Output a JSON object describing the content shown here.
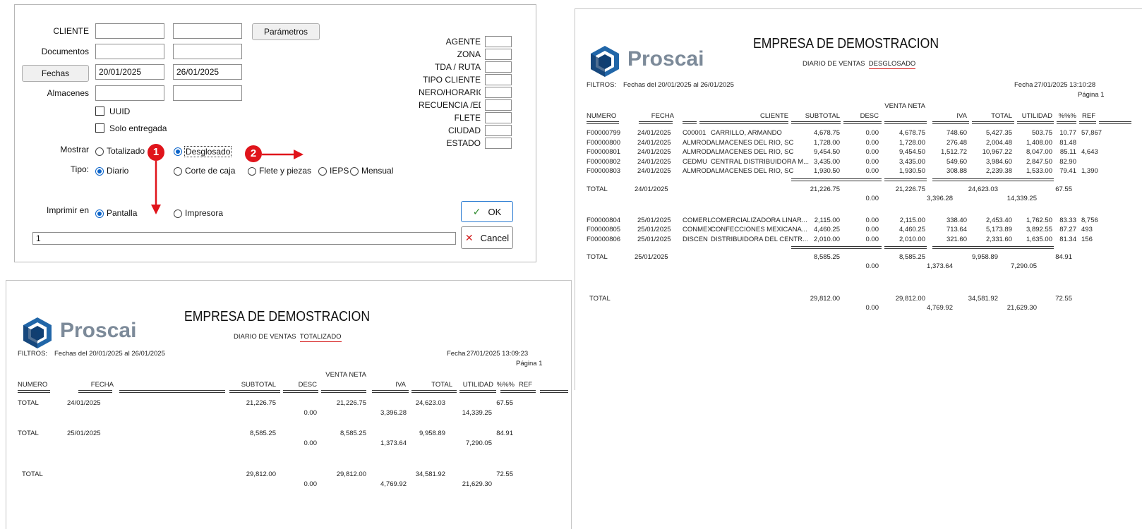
{
  "dialog": {
    "cliente_label": "CLIENTE",
    "documentos_label": "Documentos",
    "fechas_button": "Fechas",
    "fecha_desde": "20/01/2025",
    "fecha_hasta": "26/01/2025",
    "almacenes_label": "Almacenes",
    "parametros_button": "Parámetros",
    "uuid_label": "UUID",
    "solo_entregada_label": "Solo entregada",
    "mostrar_label": "Mostrar",
    "mostrar_options": [
      "Totalizado",
      "Desglosado"
    ],
    "mostrar_selected": "Desglosado",
    "tipo_label": "Tipo:",
    "tipo_options": [
      "Diario",
      "Corte de caja",
      "Flete y piezas",
      "IEPS",
      "Mensual"
    ],
    "tipo_selected": "Diario",
    "imprimir_label": "Imprimir en",
    "imprimir_options": [
      "Pantalla",
      "Impresora"
    ],
    "imprimir_selected": "Pantalla",
    "status_value": "1",
    "ok_button": "OK",
    "cancel_button": "Cancel",
    "right_filters": [
      "AGENTE",
      "ZONA",
      "TDA / RUTA",
      "TIPO CLIENTE",
      "NERO/HORARIO",
      "RECUENCIA /EDA",
      "FLETE",
      "CIUDAD",
      "ESTADO"
    ],
    "markers": [
      "1",
      "2"
    ]
  },
  "report_desglosado": {
    "logo": "Proscai",
    "title": "EMPRESA DE DEMOSTRACION",
    "subtitle_prefix": "DIARIO DE VENTAS",
    "subtitle_mode": "DESGLOSADO",
    "filtros_label": "FILTROS:",
    "filtros_text": "Fechas del 20/01/2025 al 26/01/2025",
    "fecha_label": "Fecha",
    "fecha_value": "27/01/2025 13:10:28",
    "pagina": "Página 1",
    "headers": [
      "NUMERO",
      "FECHA",
      "CLIENTE",
      "SUBTOTAL",
      "DESC",
      "VENTA NETA",
      "IVA",
      "TOTAL",
      "UTILIDAD",
      "%%%",
      "REF"
    ],
    "groups": [
      {
        "rows": [
          [
            "F00000799",
            "24/01/2025",
            "C00001",
            "CARRILLO, ARMANDO",
            "4,678.75",
            "0.00",
            "4,678.75",
            "748.60",
            "5,427.35",
            "503.75",
            "10.77",
            "57,867"
          ],
          [
            "F00000800",
            "24/01/2025",
            "ALMROD",
            "ALMACENES DEL RIO, SC",
            "1,728.00",
            "0.00",
            "1,728.00",
            "276.48",
            "2,004.48",
            "1,408.00",
            "81.48",
            ""
          ],
          [
            "F00000801",
            "24/01/2025",
            "ALMROD",
            "ALMACENES DEL RIO, SC",
            "9,454.50",
            "0.00",
            "9,454.50",
            "1,512.72",
            "10,967.22",
            "8,047.00",
            "85.11",
            "4,643"
          ],
          [
            "F00000802",
            "24/01/2025",
            "CEDMU",
            "CENTRAL DISTRIBUIDORA M...",
            "3,435.00",
            "0.00",
            "3,435.00",
            "549.60",
            "3,984.60",
            "2,847.50",
            "82.90",
            ""
          ],
          [
            "F00000803",
            "24/01/2025",
            "ALMROD",
            "ALMACENES DEL RIO, SC",
            "1,930.50",
            "0.00",
            "1,930.50",
            "308.88",
            "2,239.38",
            "1,533.00",
            "79.41",
            "1,390"
          ]
        ],
        "total": {
          "label": "TOTAL",
          "fecha": "24/01/2025",
          "subtotal": "21,226.75",
          "desc": "0.00",
          "neta": "21,226.75",
          "iva": "3,396.28",
          "total": "24,623.03",
          "utilidad": "14,339.25",
          "pct": "67.55"
        }
      },
      {
        "rows": [
          [
            "F00000804",
            "25/01/2025",
            "COMERL",
            "COMERCIALIZADORA LINAR...",
            "2,115.00",
            "0.00",
            "2,115.00",
            "338.40",
            "2,453.40",
            "1,762.50",
            "83.33",
            "8,756"
          ],
          [
            "F00000805",
            "25/01/2025",
            "CONMEX",
            "CONFECCIONES MEXICANA...",
            "4,460.25",
            "0.00",
            "4,460.25",
            "713.64",
            "5,173.89",
            "3,892.55",
            "87.27",
            "493"
          ],
          [
            "F00000806",
            "25/01/2025",
            "DISCEN",
            "DISTRIBUIDORA DEL CENTR...",
            "2,010.00",
            "0.00",
            "2,010.00",
            "321.60",
            "2,331.60",
            "1,635.00",
            "81.34",
            "156"
          ]
        ],
        "total": {
          "label": "TOTAL",
          "fecha": "25/01/2025",
          "subtotal": "8,585.25",
          "desc": "0.00",
          "neta": "8,585.25",
          "iva": "1,373.64",
          "total": "9,958.89",
          "utilidad": "7,290.05",
          "pct": "84.91"
        }
      }
    ],
    "grand_total": {
      "label": "TOTAL",
      "subtotal": "29,812.00",
      "desc": "0.00",
      "neta": "29,812.00",
      "iva": "4,769.92",
      "total": "34,581.92",
      "utilidad": "21,629.30",
      "pct": "72.55"
    }
  },
  "report_totalizado": {
    "logo": "Proscai",
    "title": "EMPRESA DE DEMOSTRACION",
    "subtitle_prefix": "DIARIO DE VENTAS",
    "subtitle_mode": "TOTALIZADO",
    "filtros_label": "FILTROS:",
    "filtros_text": "Fechas del 20/01/2025 al 26/01/2025",
    "fecha_label": "Fecha",
    "fecha_value": "27/01/2025 13:09:23",
    "pagina": "Página 1",
    "headers": [
      "NUMERO",
      "FECHA",
      "SUBTOTAL",
      "DESC",
      "VENTA NETA",
      "IVA",
      "TOTAL",
      "UTILIDAD",
      "%%%",
      "REF"
    ],
    "totals": [
      {
        "label": "TOTAL",
        "fecha": "24/01/2025",
        "subtotal": "21,226.75",
        "desc": "0.00",
        "neta": "21,226.75",
        "iva": "3,396.28",
        "total": "24,623.03",
        "utilidad": "14,339.25",
        "pct": "67.55"
      },
      {
        "label": "TOTAL",
        "fecha": "25/01/2025",
        "subtotal": "8,585.25",
        "desc": "0.00",
        "neta": "8,585.25",
        "iva": "1,373.64",
        "total": "9,958.89",
        "utilidad": "7,290.05",
        "pct": "84.91"
      },
      {
        "label": "TOTAL",
        "fecha": "",
        "subtotal": "29,812.00",
        "desc": "0.00",
        "neta": "29,812.00",
        "iva": "4,769.92",
        "total": "34,581.92",
        "utilidad": "21,629.30",
        "pct": "72.55"
      }
    ]
  }
}
